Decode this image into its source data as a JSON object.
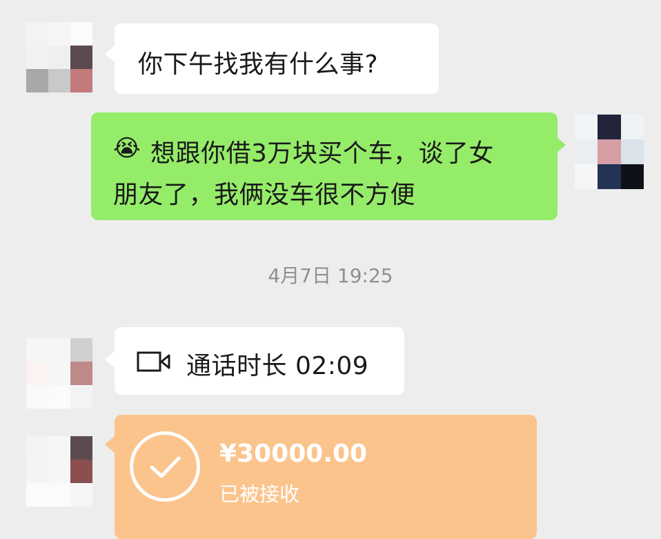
{
  "messages": [
    {
      "sender": "contact",
      "text": "你下午找我有什么事?"
    },
    {
      "sender": "me",
      "emoji": "😭",
      "line1": "想跟你借3万块买个车，谈了女",
      "line2": "朋友了，我俩没车很不方便"
    }
  ],
  "timestamp": "4月7日 19:25",
  "call": {
    "icon": "video-camera-icon",
    "label": "通话时长 02:09"
  },
  "transfer": {
    "amount": "¥30000.00",
    "status": "已被接收",
    "icon": "check-circle-icon"
  },
  "colors": {
    "background": "#ededed",
    "bubble_me": "#95ec69",
    "bubble_contact": "#ffffff",
    "transfer": "#fbc48c"
  }
}
